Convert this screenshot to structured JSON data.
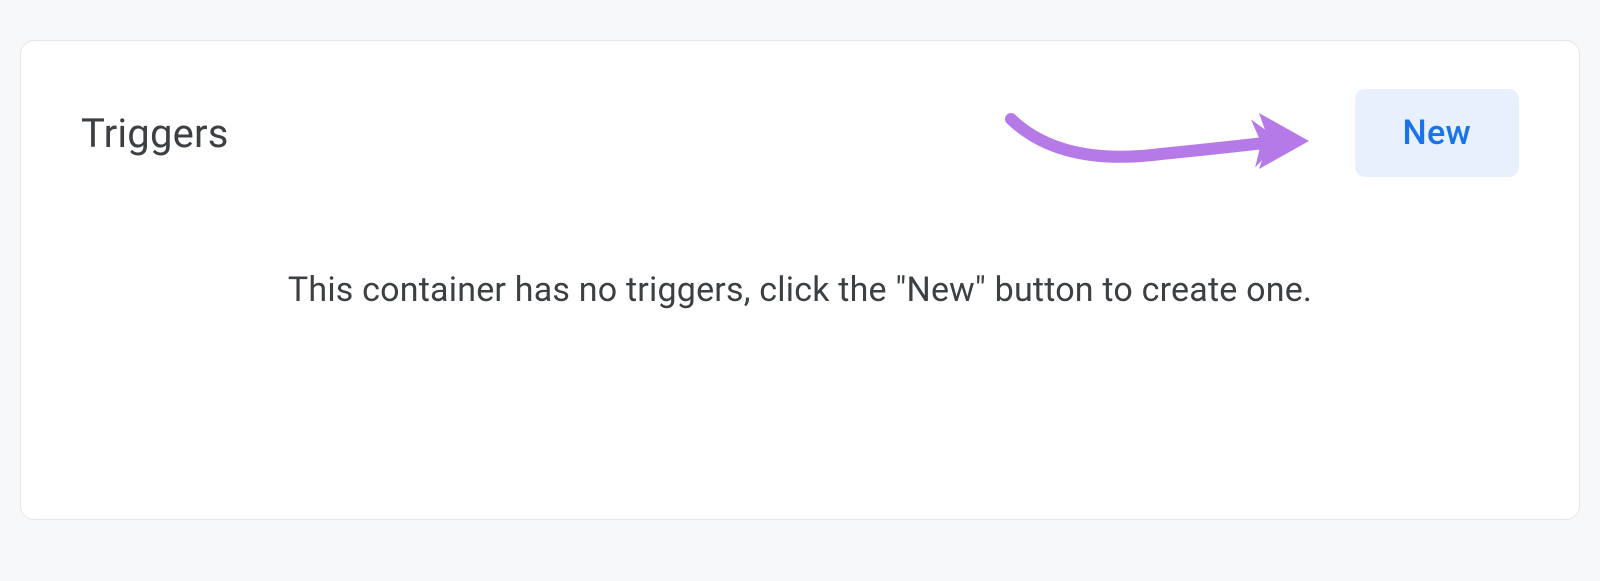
{
  "panel": {
    "title": "Triggers",
    "new_button_label": "New",
    "empty_state_message": "This container has no triggers, click the \"New\" button to create one."
  },
  "annotation": {
    "arrow_color": "#b57ae8"
  }
}
